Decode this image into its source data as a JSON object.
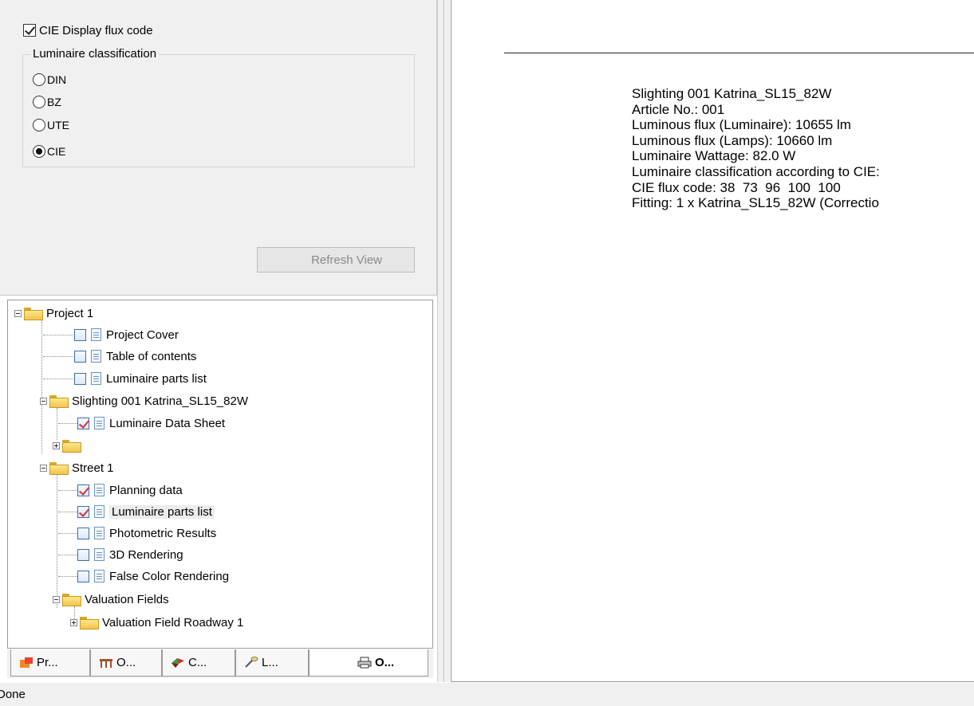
{
  "options": {
    "cie_display_flux_code_label": "CIE Display flux code",
    "cie_display_flux_code_checked": true,
    "classification_legend": "Luminaire classification",
    "classification_options": [
      "DIN",
      "BZ",
      "UTE",
      "CIE"
    ],
    "classification_selected": "CIE",
    "refresh_button_label": "Refresh View"
  },
  "tree": {
    "nodes": [
      {
        "label": "Project 1",
        "type": "folder",
        "expanded": true
      },
      {
        "label": "Project Cover",
        "type": "document",
        "checked": false
      },
      {
        "label": "Table of contents",
        "type": "document",
        "checked": false
      },
      {
        "label": "Luminaire parts list",
        "type": "document",
        "checked": false
      },
      {
        "label": "Slighting 001 Katrina_SL15_82W",
        "type": "folder",
        "expanded": true
      },
      {
        "label": "Luminaire Data Sheet",
        "type": "document",
        "checked": true
      },
      {
        "label": "",
        "type": "folder",
        "expanded": false
      },
      {
        "label": "Street 1",
        "type": "folder",
        "expanded": true
      },
      {
        "label": "Planning data",
        "type": "document",
        "checked": true
      },
      {
        "label": "Luminaire parts list",
        "type": "document",
        "checked": true,
        "selected": true
      },
      {
        "label": "Photometric Results",
        "type": "document",
        "checked": false
      },
      {
        "label": "3D Rendering",
        "type": "document",
        "checked": false
      },
      {
        "label": "False Color Rendering",
        "type": "document",
        "checked": false
      },
      {
        "label": "Valuation Fields",
        "type": "folder",
        "expanded": true
      },
      {
        "label": "Valuation Field Roadway 1",
        "type": "folder",
        "expanded": false
      }
    ]
  },
  "tabs": [
    {
      "label": "Pr...",
      "icon": "project-icon"
    },
    {
      "label": "O...",
      "icon": "furniture-icon"
    },
    {
      "label": "C...",
      "icon": "calculation-icon"
    },
    {
      "label": "L...",
      "icon": "luminaire-icon"
    },
    {
      "label": "O...",
      "icon": "printer-icon",
      "active": true
    }
  ],
  "preview": {
    "lines": [
      "Slighting 001 Katrina_SL15_82W",
      "Article No.: 001",
      "Luminous flux (Luminaire): 10655 lm",
      "Luminous flux (Lamps): 10660 lm",
      "Luminaire Wattage: 82.0 W",
      "Luminaire classification according to CIE:",
      "CIE flux code: 38  73  96  100  100",
      "Fitting: 1 x Katrina_SL15_82W (Correctio"
    ]
  },
  "status": {
    "text": "Done"
  }
}
